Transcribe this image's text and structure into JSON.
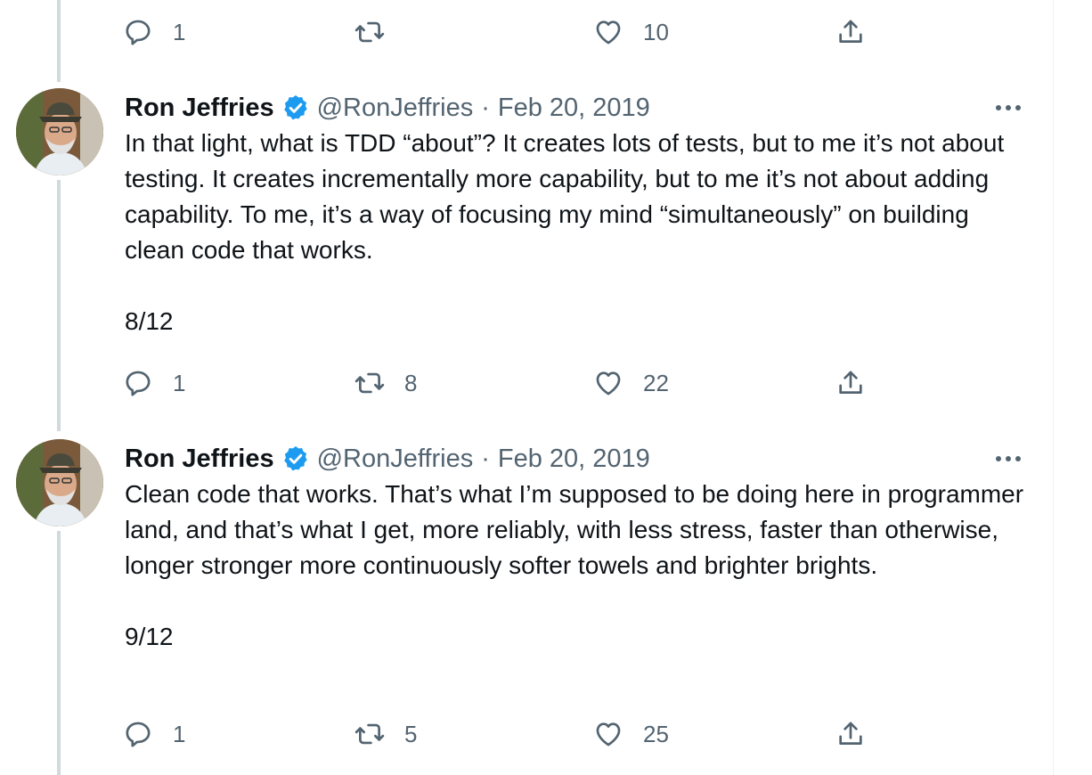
{
  "top_actions": {
    "reply_count": "1",
    "retweet_count": "",
    "like_count": "10"
  },
  "tweets": [
    {
      "name": "Ron Jeffries",
      "handle": "@RonJeffries",
      "separator": "·",
      "date": "Feb 20, 2019",
      "text": "In that light, what is TDD “about”? It creates lots of tests, but to me it’s not about testing. It creates incrementally more capability, but to me it’s not about adding capability. To me, it’s a way of focusing my mind “simultaneously” on building clean code that works.",
      "counter": "8/12",
      "reply_count": "1",
      "retweet_count": "8",
      "like_count": "22"
    },
    {
      "name": "Ron Jeffries",
      "handle": "@RonJeffries",
      "separator": "·",
      "date": "Feb 20, 2019",
      "text": "Clean code that works. That’s what I’m supposed to be doing here in programmer land, and that’s what I get, more reliably, with less stress, faster than otherwise, longer stronger more continuously softer towels and brighter brights.",
      "counter": "9/12",
      "reply_count": "1",
      "retweet_count": "5",
      "like_count": "25"
    }
  ],
  "colors": {
    "text": "#0f1419",
    "secondary": "#536471",
    "verified": "#1d9bf0",
    "thread_line": "#cfd9de"
  },
  "icons": [
    "reply-icon",
    "retweet-icon",
    "like-icon",
    "share-icon",
    "verified-badge-icon",
    "more-icon"
  ]
}
